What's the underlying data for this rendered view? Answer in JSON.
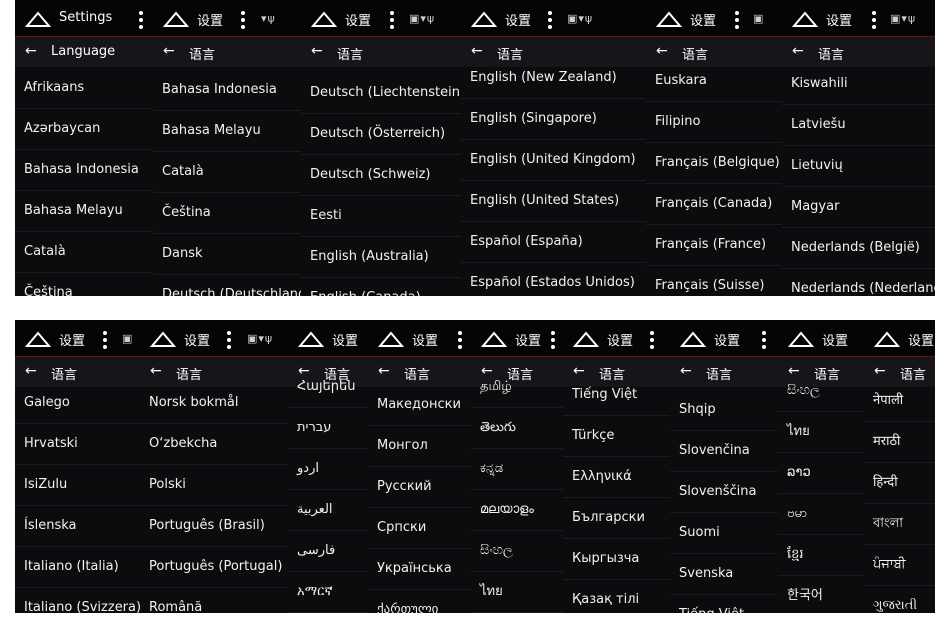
{
  "top_row": [
    {
      "title": "Settings",
      "header": "Language",
      "status": "▯",
      "items": [
        "Afrikaans",
        "Azərbaycan",
        "Bahasa Indonesia",
        "Bahasa Melayu",
        "Català",
        "Čeština"
      ]
    },
    {
      "title": "设置",
      "header": "语言",
      "status": "▾ψ",
      "items": [
        "Bahasa Indonesia",
        "Bahasa Melayu",
        "Català",
        "Čeština",
        "Dansk",
        "Deutsch (Deutschland)"
      ]
    },
    {
      "title": "设置",
      "header": "语言",
      "status": "▣▾ψ",
      "items": [
        "Deutsch (Liechtenstein)",
        "Deutsch (Österreich)",
        "Deutsch (Schweiz)",
        "Eesti",
        "English (Australia)",
        "English (Canada)"
      ]
    },
    {
      "title": "设置",
      "header": "语言",
      "status": "▣▾ψ",
      "items": [
        "English (New Zealand)",
        "English (Singapore)",
        "English (United Kingdom)",
        "English (United States)",
        "Español (España)",
        "Español (Estados Unidos)"
      ]
    },
    {
      "title": "设置",
      "header": "语言",
      "status": "▣",
      "items": [
        "Euskara",
        "Filipino",
        "Français (Belgique)",
        "Français (Canada)",
        "Français (France)",
        "Français (Suisse)"
      ]
    },
    {
      "title": "设置",
      "header": "语言",
      "status": "▣▾ψ",
      "items": [
        "Kiswahili",
        "Latviešu",
        "Lietuvių",
        "Magyar",
        "Nederlands (België)",
        "Nederlands (Nederland)"
      ]
    }
  ],
  "bottom_row": [
    {
      "title": "设置",
      "header": "语言",
      "status": "▣",
      "items": [
        "Galego",
        "Hrvatski",
        "IsiZulu",
        "Íslenska",
        "Italiano (Italia)",
        "Italiano (Svizzera)"
      ]
    },
    {
      "title": "设置",
      "header": "语言",
      "status": "▣▾ψ",
      "items": [
        "Norsk bokmål",
        "O‘zbekcha",
        "Polski",
        "Português (Brasil)",
        "Português (Portugal)",
        "Română"
      ]
    },
    {
      "title": "设置",
      "header": "语言",
      "status": "",
      "items": [
        "Հայերեն",
        "עברית",
        "اردو",
        "العربية",
        "فارسی",
        "አማርኛ"
      ]
    },
    {
      "title": "设置",
      "header": "语言",
      "status": "",
      "items": [
        "Македонски",
        "Монгол",
        "Русский",
        "Српски",
        "Українська",
        "ქართული"
      ]
    },
    {
      "title": "设置",
      "header": "语言",
      "status": "",
      "items": [
        "தமிழ்",
        "తెలుగు",
        "ಕನ್ನಡ",
        "മലയാളം",
        "සිංහල",
        "ไทย"
      ]
    },
    {
      "title": "设置",
      "header": "语言",
      "status": "",
      "items": [
        "Tiếng Việt",
        "Türkçe",
        "Ελληνικά",
        "Български",
        "Кыргызча",
        "Қазақ тілі"
      ]
    },
    {
      "title": "设置",
      "header": "语言",
      "status": "",
      "items": [
        "Shqip",
        "Slovenčina",
        "Slovenščina",
        "Suomi",
        "Svenska",
        "Tiếng Việt"
      ]
    },
    {
      "title": "设置",
      "header": "语言",
      "status": "",
      "items": [
        "සිංහල",
        "ไทย",
        "ລາວ",
        "ဗမာ",
        "ខ្មែរ",
        "한국어"
      ]
    },
    {
      "title": "设置",
      "header": "语言",
      "status": "",
      "items": [
        "नेपाली",
        "मराठी",
        "हिन्दी",
        "বাংলা",
        "ਪੰਜਾਬੀ",
        "ગુજરાતી"
      ]
    }
  ]
}
